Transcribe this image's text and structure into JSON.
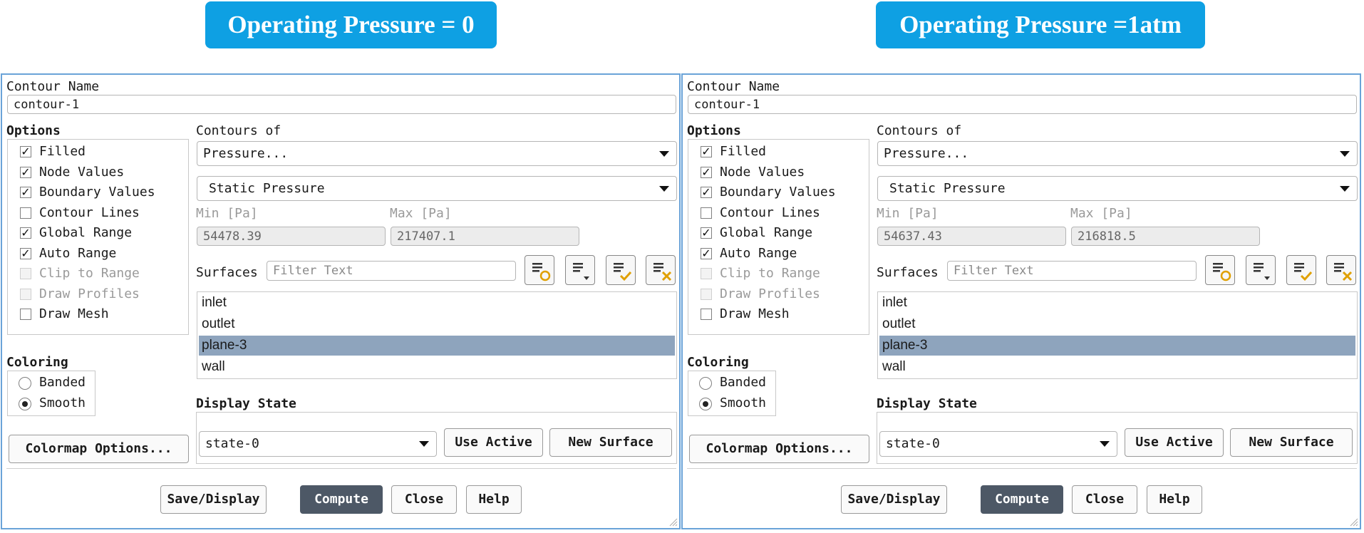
{
  "banners": {
    "left": "Operating Pressure = 0",
    "right": "Operating Pressure =1atm"
  },
  "panels": [
    {
      "contour_name_label": "Contour Name",
      "contour_name": "contour-1",
      "options_label": "Options",
      "options": [
        {
          "label": "Filled",
          "checked": true,
          "disabled": false
        },
        {
          "label": "Node Values",
          "checked": true,
          "disabled": false
        },
        {
          "label": "Boundary Values",
          "checked": true,
          "disabled": false
        },
        {
          "label": "Contour Lines",
          "checked": false,
          "disabled": false
        },
        {
          "label": "Global Range",
          "checked": true,
          "disabled": false
        },
        {
          "label": "Auto Range",
          "checked": true,
          "disabled": false
        },
        {
          "label": "Clip to Range",
          "checked": false,
          "disabled": true
        },
        {
          "label": "Draw Profiles",
          "checked": false,
          "disabled": true
        },
        {
          "label": "Draw Mesh",
          "checked": false,
          "disabled": false
        }
      ],
      "contours_of_label": "Contours of",
      "contours_of": "Pressure...",
      "contours_sub": "Static Pressure",
      "min_label": "Min [Pa]",
      "max_label": "Max [Pa]",
      "min_value": "54478.39",
      "max_value": "217407.1",
      "surfaces_label": "Surfaces",
      "filter_placeholder": "Filter Text",
      "surfaces": [
        {
          "name": "inlet",
          "selected": false
        },
        {
          "name": "outlet",
          "selected": false
        },
        {
          "name": "plane-3",
          "selected": true
        },
        {
          "name": "wall",
          "selected": false
        }
      ],
      "coloring_label": "Coloring",
      "coloring": [
        {
          "label": "Banded",
          "selected": false
        },
        {
          "label": "Smooth",
          "selected": true
        }
      ],
      "colormap_button": "Colormap Options...",
      "display_state_label": "Display State",
      "display_state": "state-0",
      "use_active": "Use Active",
      "new_surface": "New Surface",
      "footer": {
        "save_display": "Save/Display",
        "compute": "Compute",
        "close": "Close",
        "help": "Help"
      }
    },
    {
      "contour_name_label": "Contour Name",
      "contour_name": "contour-1",
      "options_label": "Options",
      "options": [
        {
          "label": "Filled",
          "checked": true,
          "disabled": false
        },
        {
          "label": "Node Values",
          "checked": true,
          "disabled": false
        },
        {
          "label": "Boundary Values",
          "checked": true,
          "disabled": false
        },
        {
          "label": "Contour Lines",
          "checked": false,
          "disabled": false
        },
        {
          "label": "Global Range",
          "checked": true,
          "disabled": false
        },
        {
          "label": "Auto Range",
          "checked": true,
          "disabled": false
        },
        {
          "label": "Clip to Range",
          "checked": false,
          "disabled": true
        },
        {
          "label": "Draw Profiles",
          "checked": false,
          "disabled": true
        },
        {
          "label": "Draw Mesh",
          "checked": false,
          "disabled": false
        }
      ],
      "contours_of_label": "Contours of",
      "contours_of": "Pressure...",
      "contours_sub": "Static Pressure",
      "min_label": "Min [Pa]",
      "max_label": "Max [Pa]",
      "min_value": "54637.43",
      "max_value": "216818.5",
      "surfaces_label": "Surfaces",
      "filter_placeholder": "Filter Text",
      "surfaces": [
        {
          "name": "inlet",
          "selected": false
        },
        {
          "name": "outlet",
          "selected": false
        },
        {
          "name": "plane-3",
          "selected": true
        },
        {
          "name": "wall",
          "selected": false
        }
      ],
      "coloring_label": "Coloring",
      "coloring": [
        {
          "label": "Banded",
          "selected": false
        },
        {
          "label": "Smooth",
          "selected": true
        }
      ],
      "colormap_button": "Colormap Options...",
      "display_state_label": "Display State",
      "display_state": "state-0",
      "use_active": "Use Active",
      "new_surface": "New Surface",
      "footer": {
        "save_display": "Save/Display",
        "compute": "Compute",
        "close": "Close",
        "help": "Help"
      }
    }
  ]
}
